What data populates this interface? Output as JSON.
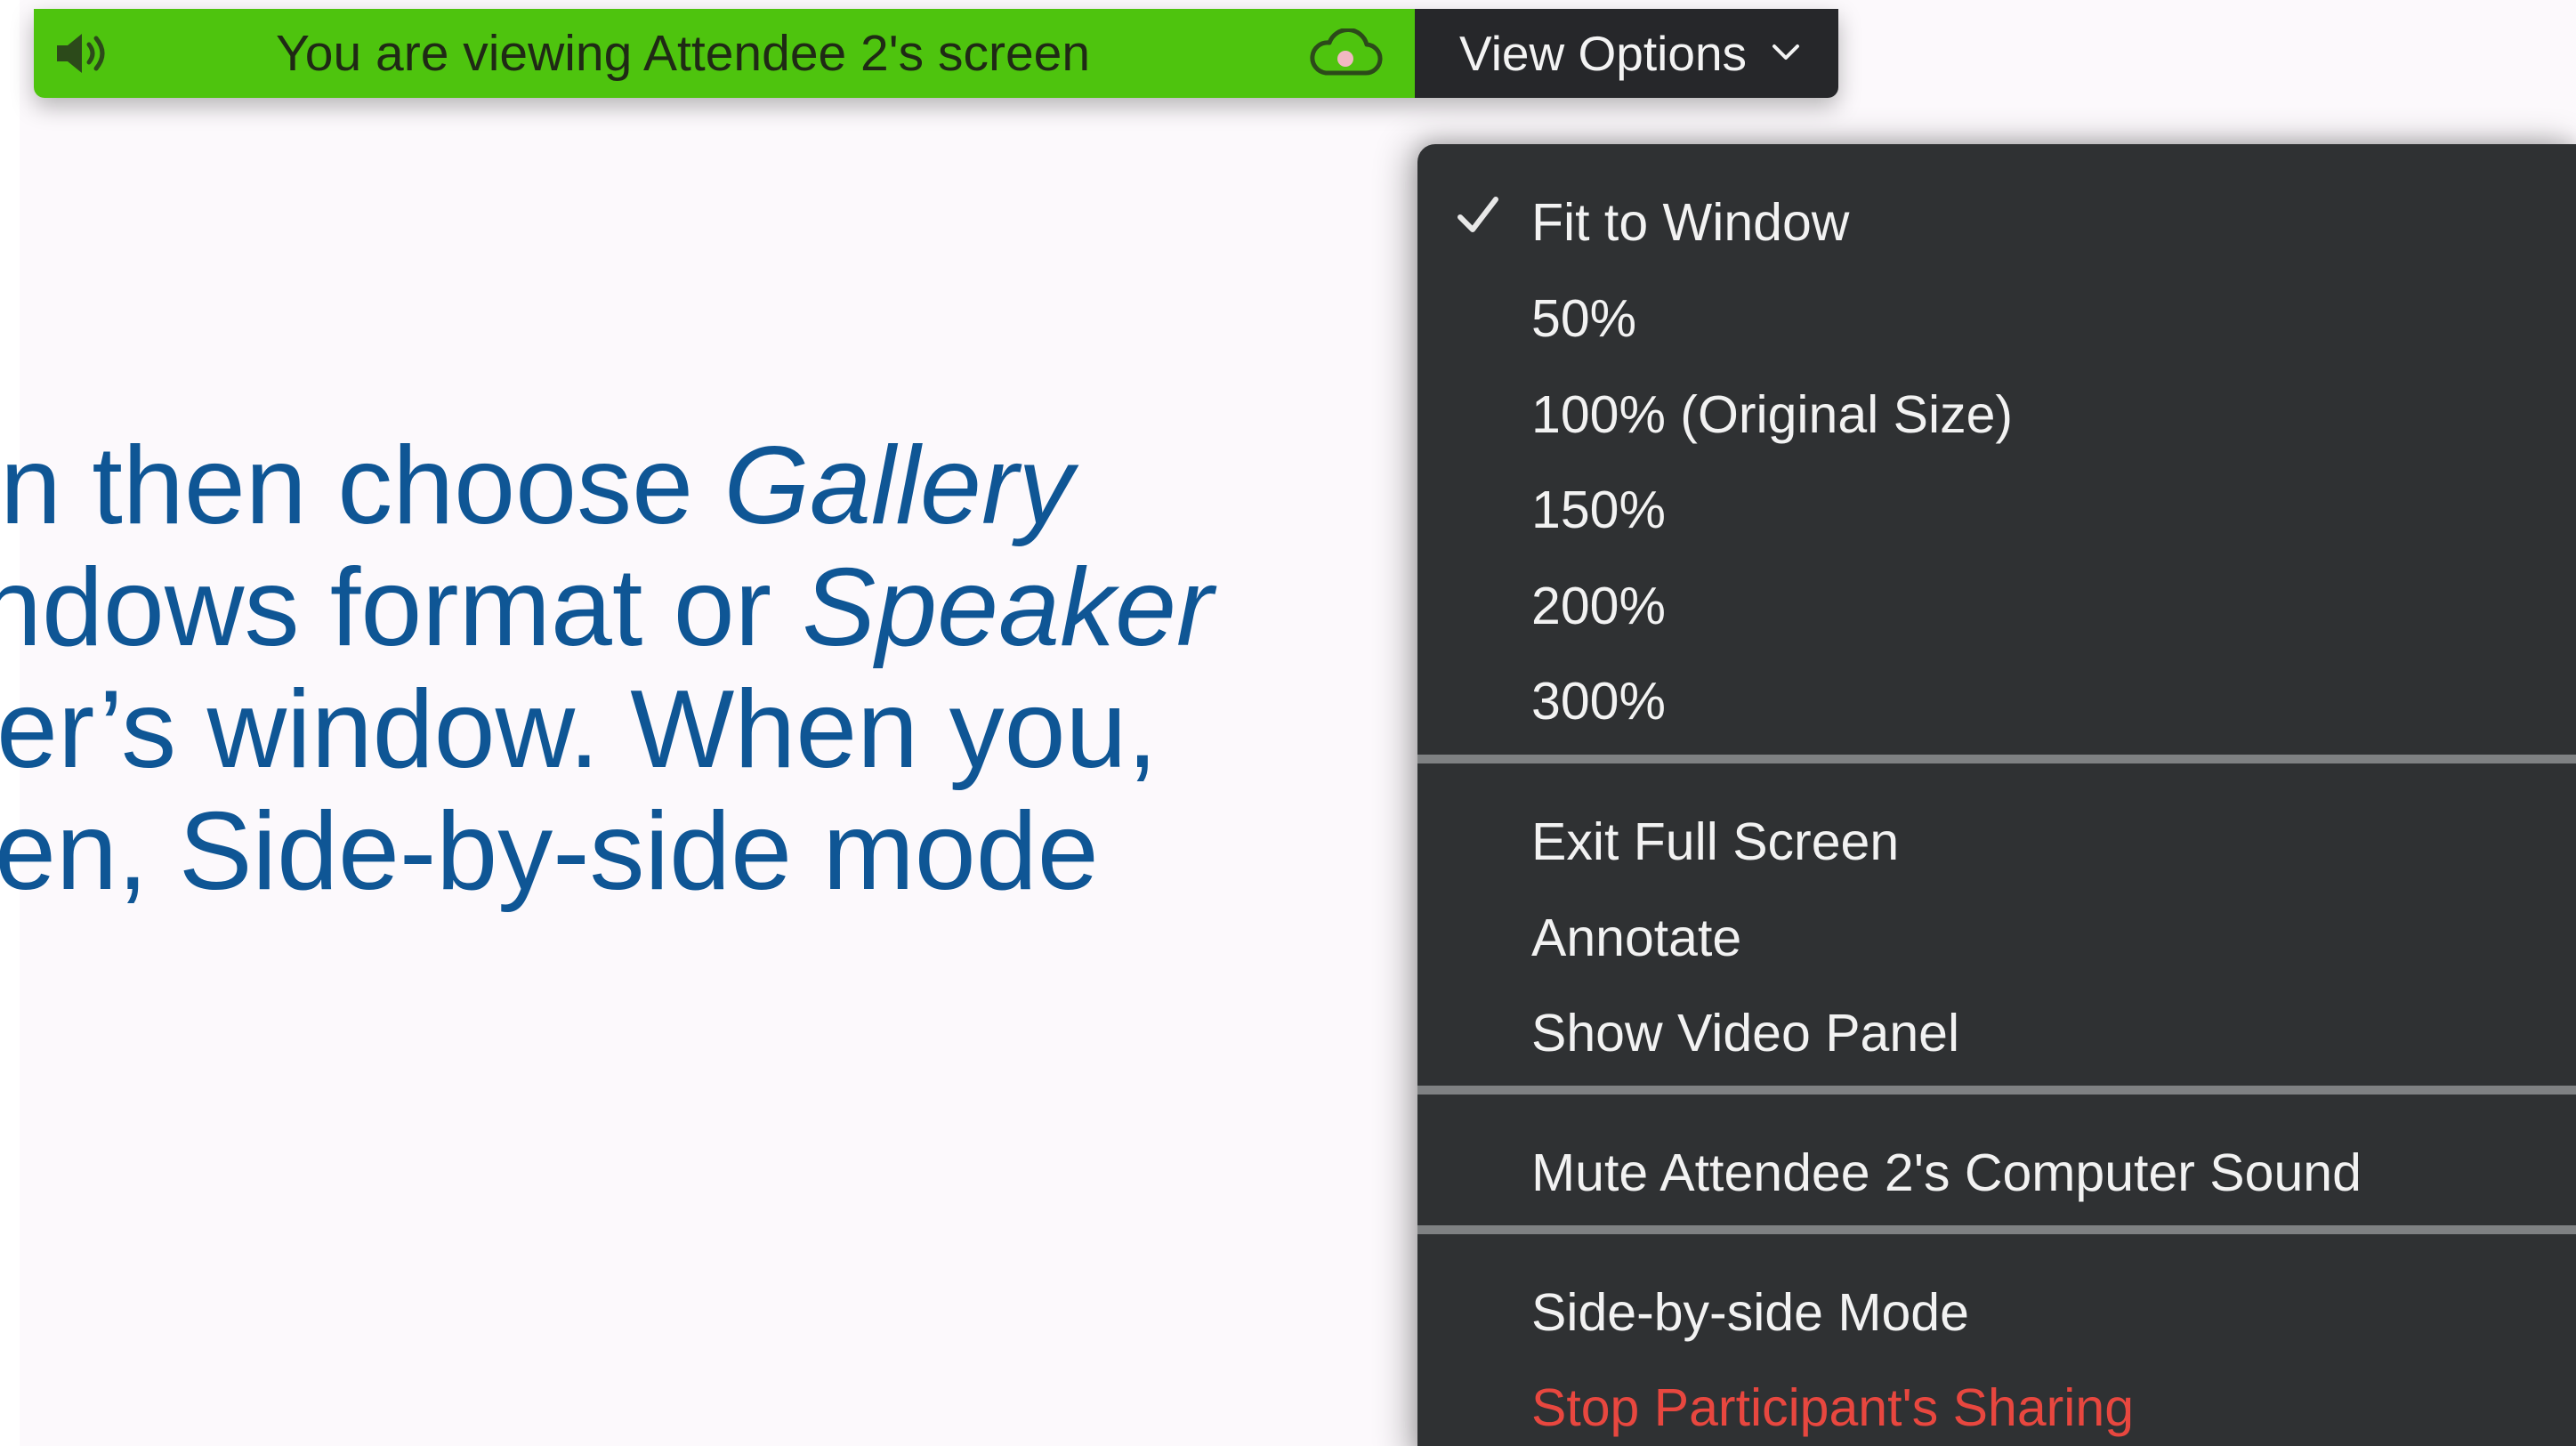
{
  "slide": {
    "lines": [
      {
        "text": "n then choose ",
        "italic": "Gallery",
        "tail": ""
      },
      {
        "text": "ndows format or ",
        "italic": "Speaker",
        "tail": ""
      },
      {
        "text": "er’s window.  When you,",
        "italic": "",
        "tail": ""
      },
      {
        "text": "en, Side-by-side mode",
        "italic": "",
        "tail": ""
      }
    ]
  },
  "banner": {
    "speaker_icon": "speaker-volume-icon",
    "message": "You are viewing Attendee 2's screen",
    "cloud_icon": "cloud-record-icon",
    "view_options_label": "View Options",
    "chevron_icon": "chevron-down-icon",
    "green_color": "#4ec40e",
    "dark_color": "#26272a"
  },
  "menu": {
    "background": "#2f3133",
    "check_icon": "checkmark-icon",
    "danger_color": "#e8473f",
    "groups": [
      {
        "items": [
          {
            "label": "Fit to Window",
            "checked": true
          },
          {
            "label": "50%",
            "checked": false
          },
          {
            "label": "100% (Original Size)",
            "checked": false
          },
          {
            "label": "150%",
            "checked": false
          },
          {
            "label": "200%",
            "checked": false
          },
          {
            "label": "300%",
            "checked": false
          }
        ]
      },
      {
        "items": [
          {
            "label": "Exit Full Screen"
          },
          {
            "label": "Annotate"
          },
          {
            "label": "Show Video Panel"
          }
        ]
      },
      {
        "items": [
          {
            "label": "Mute Attendee 2's Computer Sound"
          }
        ]
      },
      {
        "items": [
          {
            "label": "Side-by-side Mode"
          },
          {
            "label": "Stop Participant's Sharing",
            "danger": true
          }
        ]
      }
    ]
  }
}
